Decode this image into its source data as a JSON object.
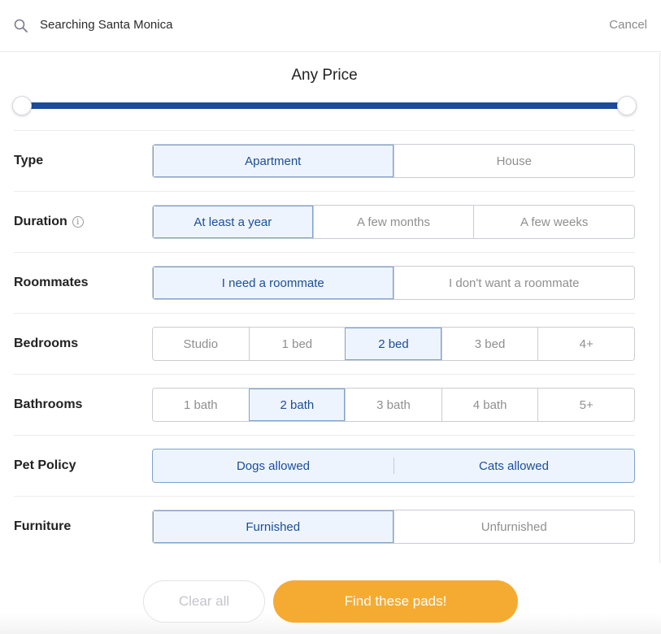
{
  "search": {
    "text": "Searching Santa Monica",
    "cancel_label": "Cancel"
  },
  "price": {
    "title": "Any Price",
    "range_min_fraction": 0.0,
    "range_max_fraction": 1.0
  },
  "filters": [
    {
      "label": "Type",
      "has_info": false,
      "options": [
        {
          "label": "Apartment",
          "selected": true
        },
        {
          "label": "House",
          "selected": false
        }
      ]
    },
    {
      "label": "Duration",
      "has_info": true,
      "options": [
        {
          "label": "At least a year",
          "selected": true
        },
        {
          "label": "A few months",
          "selected": false
        },
        {
          "label": "A few weeks",
          "selected": false
        }
      ]
    },
    {
      "label": "Roommates",
      "has_info": false,
      "options": [
        {
          "label": "I need a roommate",
          "selected": true
        },
        {
          "label": "I don't want a roommate",
          "selected": false
        }
      ]
    },
    {
      "label": "Bedrooms",
      "has_info": false,
      "options": [
        {
          "label": "Studio",
          "selected": false
        },
        {
          "label": "1 bed",
          "selected": false
        },
        {
          "label": "2 bed",
          "selected": true
        },
        {
          "label": "3 bed",
          "selected": false
        },
        {
          "label": "4+",
          "selected": false
        }
      ]
    },
    {
      "label": "Bathrooms",
      "has_info": false,
      "options": [
        {
          "label": "1 bath",
          "selected": false
        },
        {
          "label": "2 bath",
          "selected": true
        },
        {
          "label": "3 bath",
          "selected": false
        },
        {
          "label": "4 bath",
          "selected": false
        },
        {
          "label": "5+",
          "selected": false
        }
      ]
    },
    {
      "label": "Pet Policy",
      "has_info": false,
      "options": [
        {
          "label": "Dogs allowed",
          "selected": true
        },
        {
          "label": "Cats allowed",
          "selected": true
        }
      ]
    },
    {
      "label": "Furniture",
      "has_info": false,
      "options": [
        {
          "label": "Furnished",
          "selected": true
        },
        {
          "label": "Unfurnished",
          "selected": false
        }
      ]
    }
  ],
  "info_icon_glyph": "i",
  "footer": {
    "clear_label": "Clear all",
    "submit_label": "Find these pads!"
  },
  "colors": {
    "accent": "#1b4b9a",
    "selected_bg": "#edf4fd",
    "selected_text": "#1c4d99",
    "cta": "#f5ab32"
  }
}
